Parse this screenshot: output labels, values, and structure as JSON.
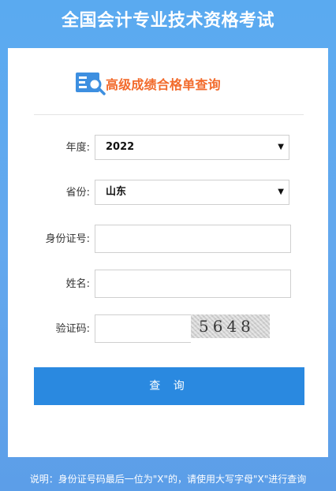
{
  "page": {
    "title": "全国会计专业技术资格考试"
  },
  "header": {
    "icon": "document-search-icon",
    "subtitle": "高级成绩合格单查询"
  },
  "form": {
    "year": {
      "label": "年度:",
      "value": "2022"
    },
    "province": {
      "label": "省份:",
      "value": "山东"
    },
    "id_number": {
      "label": "身份证号:",
      "value": ""
    },
    "name": {
      "label": "姓名:",
      "value": ""
    },
    "captcha": {
      "label": "验证码:",
      "value": "",
      "code": "5648"
    },
    "submit_label": "查 询"
  },
  "footer": {
    "note": "说明：身份证号码最后一位为\"X\"的，请使用大写字母\"X\"进行查询"
  },
  "colors": {
    "background": "#5aaaf0",
    "accent": "#2a89e0",
    "subtitle": "#f26a2b"
  }
}
